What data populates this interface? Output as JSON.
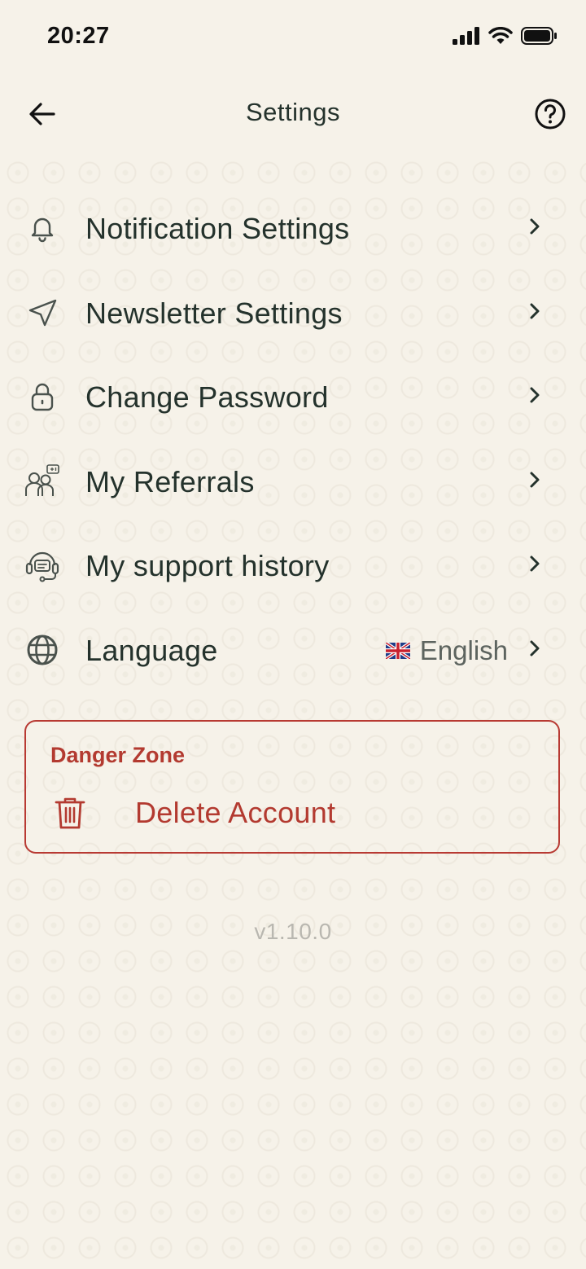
{
  "status_bar": {
    "time": "20:27"
  },
  "header": {
    "title": "Settings",
    "back_icon": "arrow-left-icon",
    "help_icon": "question-circle-icon"
  },
  "menu": {
    "items": [
      {
        "label": "Notification Settings",
        "icon": "bell-icon"
      },
      {
        "label": "Newsletter Settings",
        "icon": "send-icon"
      },
      {
        "label": "Change Password",
        "icon": "lock-icon"
      },
      {
        "label": "My Referrals",
        "icon": "people-icon"
      },
      {
        "label": "My support history",
        "icon": "headset-icon"
      },
      {
        "label": "Language",
        "icon": "globe-icon",
        "value": "English",
        "value_icon": "uk-flag-icon"
      }
    ]
  },
  "danger_zone": {
    "title": "Danger Zone",
    "delete_label": "Delete Account",
    "color": "#b33a30"
  },
  "version": "v1.10.0",
  "colors": {
    "background": "#f6f2e9",
    "text": "#24322c",
    "danger": "#b33a30"
  }
}
